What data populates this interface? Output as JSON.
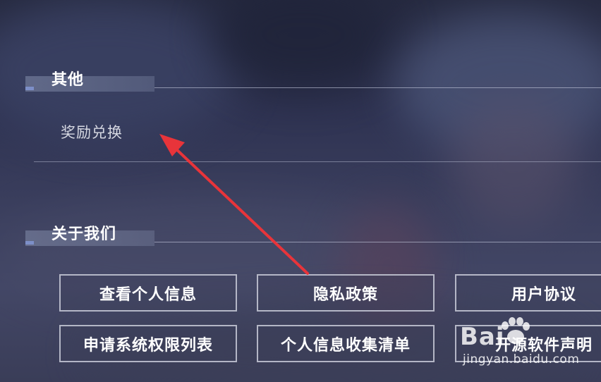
{
  "sections": {
    "other": {
      "title": "其他",
      "items": [
        {
          "label": "奖励兑换"
        }
      ]
    },
    "about": {
      "title": "关于我们",
      "buttons": [
        {
          "label": "查看个人信息"
        },
        {
          "label": "隐私政策"
        },
        {
          "label": "用户协议"
        },
        {
          "label": "申请系统权限列表"
        },
        {
          "label": "个人信息收集清单"
        },
        {
          "label": "开源软件声明"
        }
      ]
    }
  },
  "watermark": {
    "logo": "Bai",
    "url": "jingyan.baidu.com"
  },
  "colors": {
    "accent": "#7d8fc8",
    "arrow": "#e8343a"
  }
}
